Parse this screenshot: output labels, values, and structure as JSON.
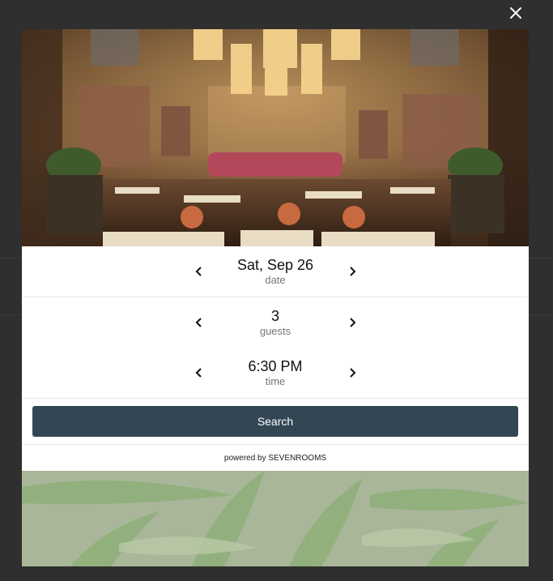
{
  "modal": {
    "close_icon": "close-icon",
    "hero_image": "restaurant-dining-room-photo",
    "date": {
      "value": "Sat, Sep 26",
      "caption": "date"
    },
    "guests": {
      "value": "3",
      "caption": "guests"
    },
    "time": {
      "value": "6:30 PM",
      "caption": "time"
    },
    "prev_icon": "chevron-left-icon",
    "next_icon": "chevron-right-icon",
    "search_label": "Search",
    "powered_by": "powered by SEVENROOMS",
    "footer_image": "palm-leaves-background"
  },
  "colors": {
    "overlay": "#2b2b2b",
    "search_button": "#324654",
    "caption_text": "#777777"
  }
}
